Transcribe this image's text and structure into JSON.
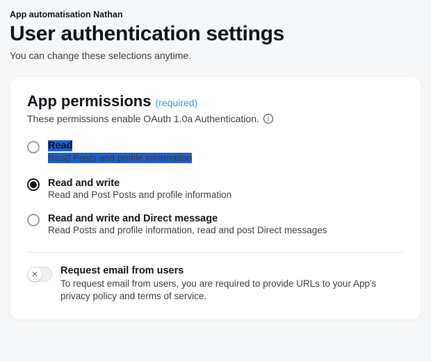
{
  "breadcrumb": "App automatisation Nathan",
  "page_title": "User authentication settings",
  "subtitle": "You can change these selections anytime.",
  "card": {
    "section_title": "App permissions",
    "required_label": "(required)",
    "section_desc": "These permissions enable OAuth 1.0a Authentication.",
    "options": [
      {
        "title": "Read",
        "desc": "Read Posts and profile information",
        "selected": false,
        "highlighted": true
      },
      {
        "title": "Read and write",
        "desc": "Read and Post Posts and profile information",
        "selected": true,
        "highlighted": false
      },
      {
        "title": "Read and write and Direct message",
        "desc": "Read Posts and profile information, read and post Direct messages",
        "selected": false,
        "highlighted": false
      }
    ],
    "toggle": {
      "on": false,
      "title": "Request email from users",
      "desc": "To request email from users, you are required to provide URLs to your App's privacy policy and terms of service."
    }
  }
}
